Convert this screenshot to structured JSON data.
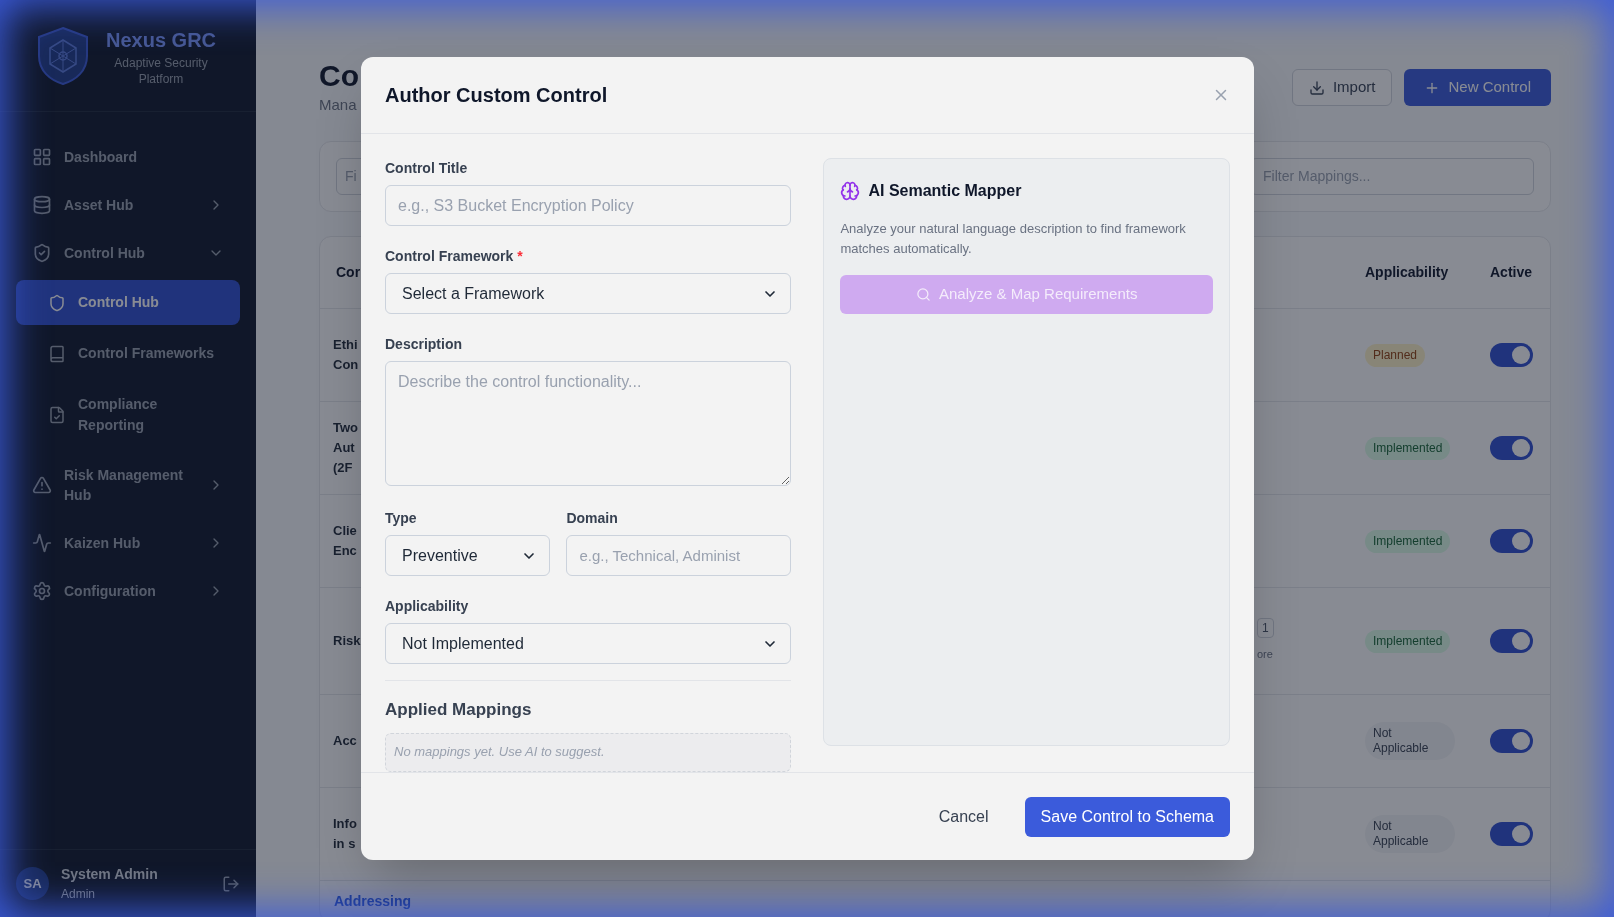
{
  "sidebar": {
    "brand": {
      "name": "Nexus GRC",
      "tagline": "Adaptive Security Platform"
    },
    "items": [
      {
        "label": "Dashboard",
        "selected": false
      },
      {
        "label": "Asset Hub",
        "selected": false,
        "expanded": false
      },
      {
        "label": "Control Hub",
        "selected": false,
        "expanded": true,
        "children": [
          {
            "label": "Control Hub",
            "selected": true
          },
          {
            "label": "Control Frameworks",
            "selected": false
          },
          {
            "label": "Compliance Reporting",
            "selected": false
          }
        ]
      },
      {
        "label": "Risk Management Hub",
        "selected": false,
        "expanded": false
      },
      {
        "label": "Kaizen Hub",
        "selected": false,
        "expanded": false
      },
      {
        "label": "Configuration",
        "selected": false,
        "expanded": false
      }
    ],
    "user": {
      "initials": "SA",
      "name": "System Admin",
      "role": "Admin"
    }
  },
  "page": {
    "title": "Co",
    "subtitle": "Mana",
    "import_button": "Import",
    "new_button": "New Control",
    "filter_left": "Fi",
    "filter_placeholder": "Filter Mappings..."
  },
  "table": {
    "columns": [
      "Cor",
      "Applicability",
      "Active"
    ],
    "rows": [
      {
        "cell_1": [
          "Ethi",
          "Con"
        ],
        "applicability": "Planned",
        "kind": "planned",
        "active": true
      },
      {
        "cell_1": [
          "Two",
          "Aut",
          "(2F"
        ],
        "applicability": "Implemented",
        "kind": "implemented",
        "active": true
      },
      {
        "cell_1": [
          "Clie",
          "Enc"
        ],
        "applicability": "Implemented",
        "kind": "implemented",
        "active": true
      },
      {
        "cell_1": [
          "Risk"
        ],
        "mapping_chip": "1",
        "mapping_more": "ore",
        "applicability": "Implemented",
        "kind": "implemented",
        "active": true
      },
      {
        "cell_1": [
          "Acc"
        ],
        "applicability": "Not Applicable",
        "kind": "na",
        "active": true
      },
      {
        "cell_1": [
          "Info",
          "in s"
        ],
        "applicability": "Not Applicable",
        "kind": "na",
        "active": true
      }
    ],
    "next_row": "Addressing"
  },
  "modal": {
    "title": "Author Custom Control",
    "fields": {
      "title_label": "Control Title",
      "title_placeholder": "e.g., S3 Bucket Encryption Policy",
      "framework_label": "Control Framework",
      "required_mark": "*",
      "framework_value": "Select a Framework",
      "description_label": "Description",
      "description_placeholder": "Describe the control functionality...",
      "type_label": "Type",
      "type_value": "Preventive",
      "domain_label": "Domain",
      "domain_placeholder": "e.g., Technical, Administ",
      "applicability_label": "Applicability",
      "applicability_value": "Not Implemented"
    },
    "mappings": {
      "heading": "Applied Mappings",
      "empty": "No mappings yet. Use AI to suggest."
    },
    "ai": {
      "title": "AI Semantic Mapper",
      "description": "Analyze your natural language description to find framework matches automatically.",
      "button": "Analyze & Map Requirements",
      "disabled": true
    },
    "cancel": "Cancel",
    "save": "Save Control to Schema"
  }
}
